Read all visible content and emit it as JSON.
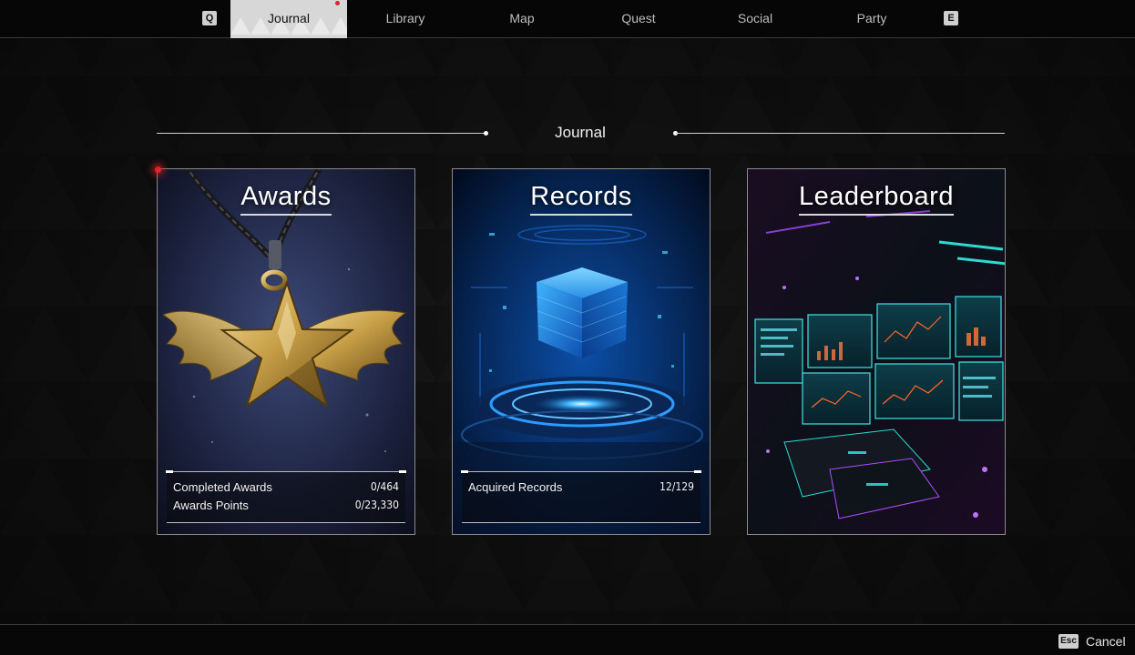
{
  "nav": {
    "prev_key": "Q",
    "next_key": "E",
    "tabs": [
      {
        "label": "Journal",
        "active": true
      },
      {
        "label": "Library",
        "active": false
      },
      {
        "label": "Map",
        "active": false
      },
      {
        "label": "Quest",
        "active": false
      },
      {
        "label": "Social",
        "active": false
      },
      {
        "label": "Party",
        "active": false
      }
    ]
  },
  "section": {
    "title": "Journal"
  },
  "cards": {
    "awards": {
      "title": "Awards",
      "stats": [
        {
          "label": "Completed Awards",
          "value": "0/464"
        },
        {
          "label": "Awards Points",
          "value": "0/23,330"
        }
      ]
    },
    "records": {
      "title": "Records",
      "stats": [
        {
          "label": "Acquired Records",
          "value": "12/129"
        }
      ]
    },
    "leaderboard": {
      "title": "Leaderboard"
    }
  },
  "footer": {
    "key": "Esc",
    "cancel_label": "Cancel"
  },
  "colors": {
    "accent": "#e9e9e9",
    "notification": "#e0222a",
    "background": "#0b0b0b"
  }
}
